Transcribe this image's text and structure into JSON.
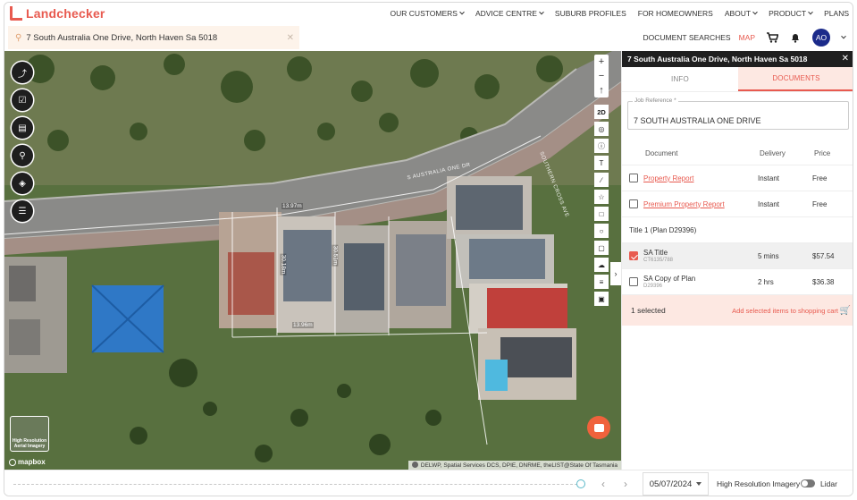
{
  "brand": {
    "name": "Landchecker",
    "accent": "#e85a4f"
  },
  "nav": {
    "items": [
      {
        "label": "OUR CUSTOMERS",
        "dropdown": true
      },
      {
        "label": "ADVICE CENTRE",
        "dropdown": true
      },
      {
        "label": "SUBURB PROFILES",
        "dropdown": false
      },
      {
        "label": "FOR HOMEOWNERS",
        "dropdown": false
      },
      {
        "label": "ABOUT",
        "dropdown": true
      },
      {
        "label": "PRODUCT",
        "dropdown": true
      },
      {
        "label": "PLANS",
        "dropdown": false
      }
    ]
  },
  "search": {
    "value": "7 South Australia One Drive, North Haven Sa 5018",
    "placeholder": ""
  },
  "subbar": {
    "document_searches": "DOCUMENT SEARCHES",
    "map": "MAP",
    "avatar_initials": "AO"
  },
  "map": {
    "zoom_in": "+",
    "zoom_out": "−",
    "compass": "↑",
    "view_2d": "2D",
    "road_label": "S AUSTRALIA ONE DR",
    "road_label_2": "SOUTHERN CROSS AVE",
    "dims": [
      "13.97m",
      "13.96m",
      "30.18m",
      "30.51m",
      "14.22m"
    ],
    "hires_label": "High Resolution Aerial Imagery",
    "mapbox": "mapbox",
    "attribution": "DELWP, Spatial Services DCS, DPIE, DNRME, theLIST@State Of Tasmania"
  },
  "timeline": {
    "date": "05/07/2024",
    "hires": "High Resolution Imagery",
    "lidar": "Lidar"
  },
  "panel": {
    "title": "7 South Australia One Drive, North Haven Sa 5018",
    "tabs": [
      {
        "label": "INFO",
        "active": false
      },
      {
        "label": "DOCUMENTS",
        "active": true
      }
    ],
    "job_ref_label": "Job Reference *",
    "job_ref_value": "7 SOUTH AUSTRALIA ONE DRIVE",
    "columns": [
      "Document",
      "Delivery",
      "Price"
    ],
    "reports": [
      {
        "name": "Property Report",
        "delivery": "Instant",
        "price": "Free",
        "checked": false
      },
      {
        "name": "Premium Property Report",
        "delivery": "Instant",
        "price": "Free",
        "checked": false
      }
    ],
    "section_title": "Title 1 (Plan D29396)",
    "titles": [
      {
        "name": "SA Title",
        "sub": "CT6135/788",
        "delivery": "5 mins",
        "price": "$57.54",
        "checked": true
      },
      {
        "name": "SA Copy of Plan",
        "sub": "D29396",
        "delivery": "2 hrs",
        "price": "$36.38",
        "checked": false
      }
    ],
    "selected_count": "1 selected",
    "add_to_cart": "Add selected items to shopping cart"
  }
}
